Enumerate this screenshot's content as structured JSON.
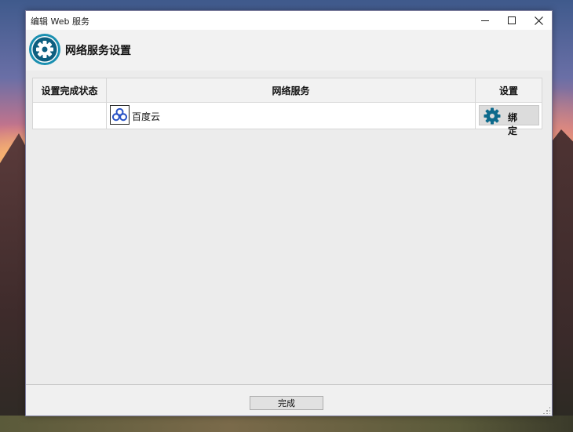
{
  "window": {
    "title": "编辑 Web 服务",
    "minimize_icon": "minimize-icon",
    "maximize_icon": "maximize-icon",
    "close_icon": "close-icon"
  },
  "header": {
    "icon": "gear-icon",
    "title": "网络服务设置"
  },
  "table": {
    "columns": [
      "设置完成状态",
      "网络服务",
      "设置"
    ],
    "rows": [
      {
        "status": "",
        "service_icon": "baidu-cloud-logo",
        "service_name": "百度云",
        "action_icon": "gear-icon",
        "action_label": "绑定"
      }
    ]
  },
  "footer": {
    "done_label": "完成"
  },
  "colors": {
    "gear_blue": "#0d6a8c",
    "accent_teal": "#1a8fb0",
    "window_bg": "#ececec"
  }
}
